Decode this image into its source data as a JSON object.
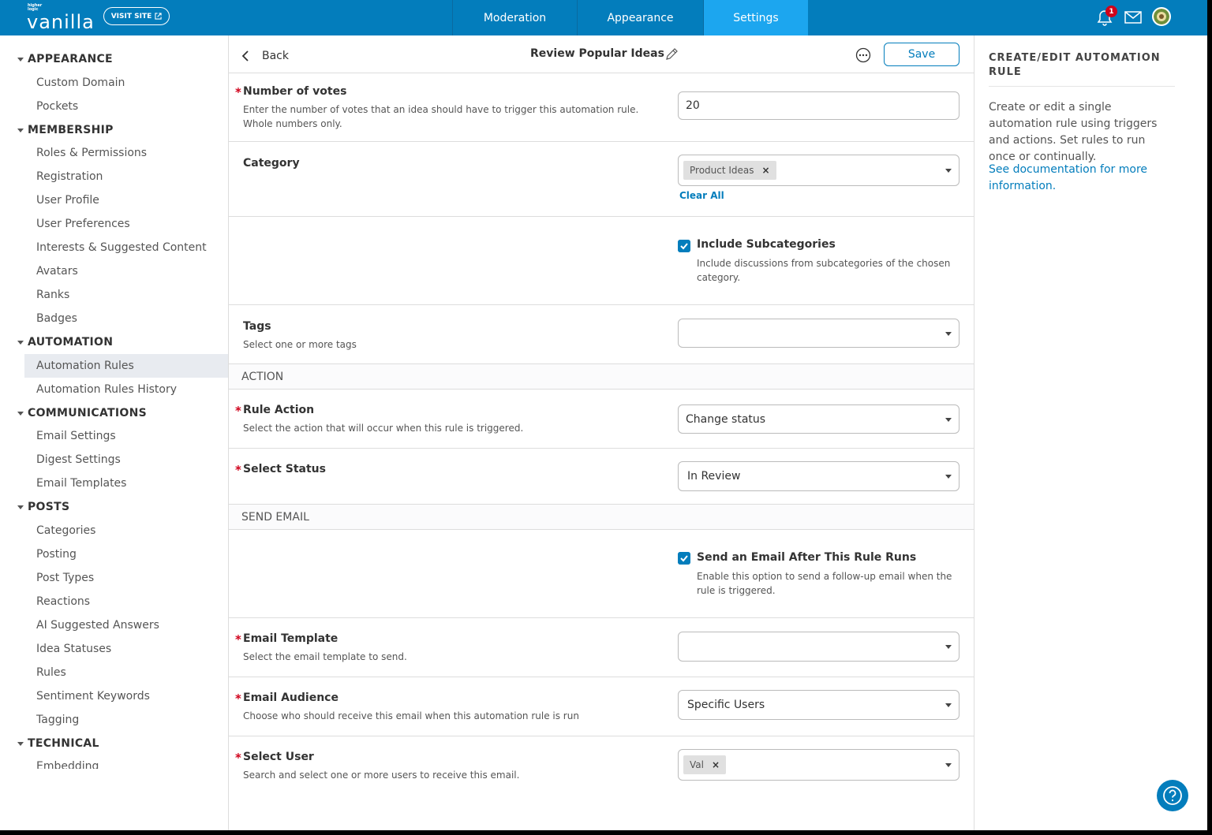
{
  "topbar": {
    "logo_small": "higher logic",
    "logo_big": "vanilla",
    "visit_site": "VISIT SITE",
    "tabs": [
      {
        "label": "Moderation"
      },
      {
        "label": "Appearance"
      },
      {
        "label": "Settings",
        "active": true
      }
    ],
    "notification_count": "1"
  },
  "sidebar": {
    "sections": [
      {
        "title": "APPEARANCE",
        "items": [
          "Custom Domain",
          "Pockets"
        ]
      },
      {
        "title": "MEMBERSHIP",
        "items": [
          "Roles & Permissions",
          "Registration",
          "User Profile",
          "User Preferences",
          "Interests & Suggested Content",
          "Avatars",
          "Ranks",
          "Badges"
        ]
      },
      {
        "title": "AUTOMATION",
        "items": [
          "Automation Rules",
          "Automation Rules History"
        ]
      },
      {
        "title": "COMMUNICATIONS",
        "items": [
          "Email Settings",
          "Digest Settings",
          "Email Templates"
        ]
      },
      {
        "title": "POSTS",
        "items": [
          "Categories",
          "Posting",
          "Post Types",
          "Reactions",
          "AI Suggested Answers",
          "Idea Statuses",
          "Rules",
          "Sentiment Keywords",
          "Tagging"
        ]
      },
      {
        "title": "TECHNICAL",
        "items": [
          "Embedding"
        ]
      }
    ],
    "active_item": "Automation Rules"
  },
  "header": {
    "back": "Back",
    "title": "Review Popular Ideas",
    "save": "Save"
  },
  "form": {
    "votes": {
      "label": "Number of votes",
      "desc": "Enter the number of votes that an idea should have to trigger this automation rule. Whole numbers only.",
      "value": "20"
    },
    "category": {
      "label": "Category",
      "token": "Product Ideas",
      "clear_all": "Clear All"
    },
    "subcategories": {
      "label": "Include Subcategories",
      "desc": "Include discussions from subcategories of the chosen category.",
      "checked": true
    },
    "tags": {
      "label": "Tags",
      "desc": "Select one or more tags",
      "value": ""
    },
    "action_section": "ACTION",
    "rule_action": {
      "label": "Rule Action",
      "desc": "Select the action that will occur when this rule is triggered.",
      "value": "Change status"
    },
    "select_status": {
      "label": "Select Status",
      "value": "In Review"
    },
    "email_section": "SEND EMAIL",
    "send_email": {
      "label": "Send an Email After This Rule Runs",
      "desc": "Enable this option to send a follow-up email when the rule is triggered.",
      "checked": true
    },
    "email_template": {
      "label": "Email Template",
      "desc": "Select the email template to send.",
      "value": ""
    },
    "email_audience": {
      "label": "Email Audience",
      "desc": "Choose who should receive this email when this automation rule is run",
      "value": "Specific Users"
    },
    "select_user": {
      "label": "Select User",
      "desc": "Search and select one or more users to receive this email.",
      "token": "Val"
    }
  },
  "right_panel": {
    "title": "CREATE/EDIT AUTOMATION RULE",
    "text": "Create or edit a single automation rule using triggers and actions. Set rules to run once or continually.",
    "link": "See documentation for more information."
  },
  "colors": {
    "brand": "#037dbc",
    "active_tab": "#1ca6ef",
    "required": "#d0021b"
  }
}
